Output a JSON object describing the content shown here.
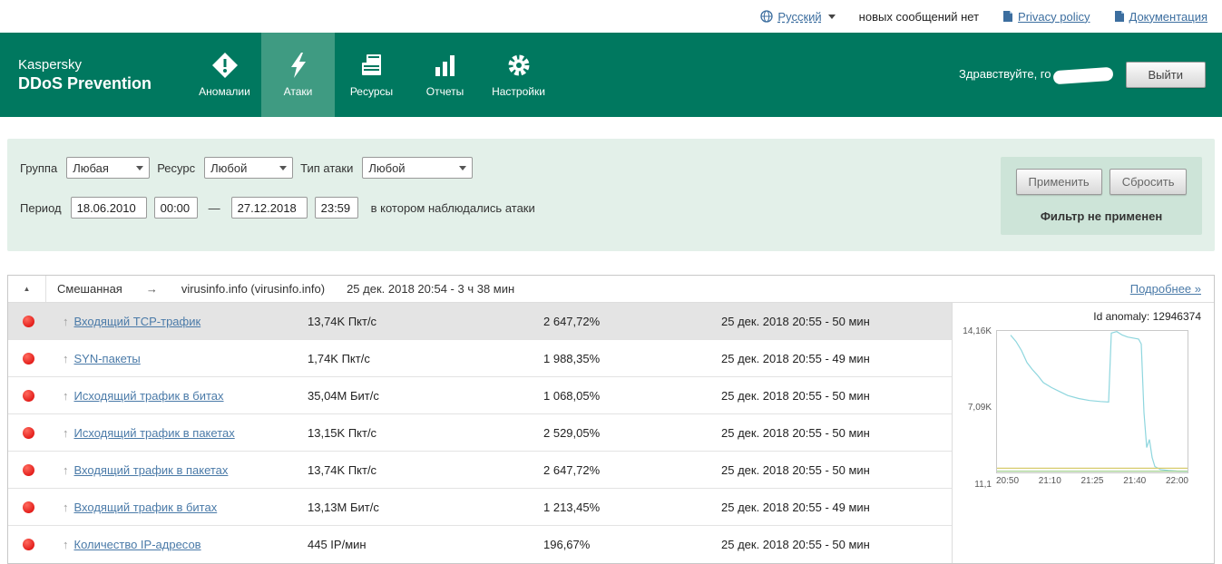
{
  "topbar": {
    "language": "Русский",
    "messages": "новых сообщений нет",
    "privacy": "Privacy policy",
    "docs": "Документация"
  },
  "header": {
    "brand_line1": "Kaspersky",
    "brand_line2": "DDoS Prevention",
    "nav": [
      {
        "label": "Аномалии"
      },
      {
        "label": "Атаки"
      },
      {
        "label": "Ресурсы"
      },
      {
        "label": "Отчеты"
      },
      {
        "label": "Настройки"
      }
    ],
    "greeting": "Здравствуйте, го",
    "logout": "Выйти"
  },
  "filters": {
    "group_label": "Группа",
    "group_value": "Любая",
    "resource_label": "Ресурс",
    "resource_value": "Любой",
    "attack_type_label": "Тип атаки",
    "attack_type_value": "Любой",
    "period_label": "Период",
    "date_from": "18.06.2010",
    "time_from": "00:00",
    "dash": "—",
    "date_to": "27.12.2018",
    "time_to": "23:59",
    "period_hint": "в котором наблюдались атаки",
    "apply": "Применить",
    "reset": "Сбросить",
    "status": "Фильтр не применен"
  },
  "attack_header": {
    "collapse": "▲",
    "type": "Смешанная",
    "arrow": "→",
    "resource": "virusinfo.info (virusinfo.info)",
    "period": "25 дек. 2018 20:54 -  3 ч 38 мин",
    "details": "Подробнее »"
  },
  "rows": [
    {
      "name": "Входящий TCP-трафик",
      "value": "13,74K Пкт/с",
      "percent": "2 647,72%",
      "time": "25 дек. 2018 20:55 - 50 мин"
    },
    {
      "name": "SYN-пакеты",
      "value": "1,74K Пкт/с",
      "percent": "1 988,35%",
      "time": "25 дек. 2018 20:55 - 49 мин"
    },
    {
      "name": "Исходящий трафик в битах",
      "value": "35,04M Бит/с",
      "percent": "1 068,05%",
      "time": "25 дек. 2018 20:55 - 50 мин"
    },
    {
      "name": "Исходящий трафик в пакетах",
      "value": "13,15K Пкт/с",
      "percent": "2 529,05%",
      "time": "25 дек. 2018 20:55 - 50 мин"
    },
    {
      "name": "Входящий трафик в пакетах",
      "value": "13,74K Пкт/с",
      "percent": "2 647,72%",
      "time": "25 дек. 2018 20:55 - 50 мин"
    },
    {
      "name": "Входящий трафик в битах",
      "value": "13,13M Бит/с",
      "percent": "1 213,45%",
      "time": "25 дек. 2018 20:55 - 49 мин"
    },
    {
      "name": "Количество IP-адресов",
      "value": "445 IP/мин",
      "percent": "196,67%",
      "time": "25 дек. 2018 20:55 - 50 мин"
    }
  ],
  "chart_data": {
    "type": "line",
    "title": "Id anomaly: 12946374",
    "x_ticks": [
      "20:50",
      "21:10",
      "21:25",
      "21:40",
      "22:00"
    ],
    "y_ticks": [
      "14,16K",
      "7,09K",
      "11,1"
    ],
    "xlim_minutes": [
      0,
      70
    ],
    "ylim": [
      11,
      14160
    ],
    "line_color": "#8ed6de",
    "series": [
      {
        "name": "traffic",
        "color": "#8ed6de",
        "points": [
          [
            5,
            13740
          ],
          [
            7,
            13100
          ],
          [
            9,
            12200
          ],
          [
            11,
            11000
          ],
          [
            13,
            10300
          ],
          [
            15,
            9700
          ],
          [
            17,
            9000
          ],
          [
            20,
            8500
          ],
          [
            23,
            8100
          ],
          [
            26,
            7700
          ],
          [
            30,
            7400
          ],
          [
            34,
            7200
          ],
          [
            38,
            7100
          ],
          [
            41,
            7050
          ],
          [
            42,
            13950
          ],
          [
            44,
            14100
          ],
          [
            46,
            13750
          ],
          [
            48,
            13550
          ],
          [
            50,
            13450
          ],
          [
            52,
            13350
          ],
          [
            53,
            12850
          ],
          [
            54,
            6000
          ],
          [
            55,
            2500
          ],
          [
            56,
            3300
          ],
          [
            57,
            1500
          ],
          [
            58,
            600
          ],
          [
            60,
            300
          ],
          [
            63,
            200
          ],
          [
            66,
            150
          ],
          [
            70,
            120
          ]
        ]
      },
      {
        "name": "threshold",
        "color": "#d8cc6e",
        "points": [
          [
            0,
            430
          ],
          [
            70,
            430
          ]
        ]
      },
      {
        "name": "baseline",
        "color": "#9acb84",
        "points": [
          [
            0,
            130
          ],
          [
            70,
            130
          ]
        ]
      }
    ]
  }
}
